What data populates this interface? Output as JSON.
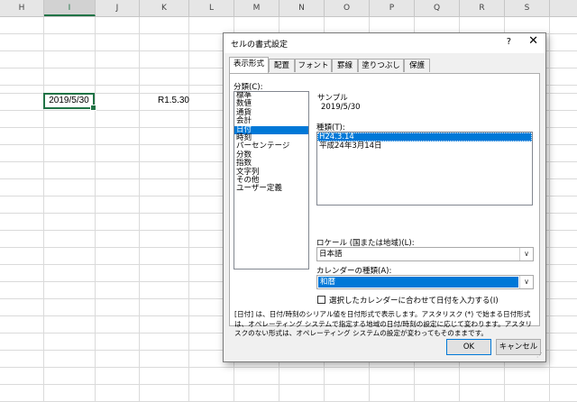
{
  "spreadsheet": {
    "columns": [
      "H",
      "I",
      "J",
      "K",
      "L",
      "M",
      "N",
      "O",
      "P",
      "Q",
      "R",
      "S"
    ],
    "active_cell_value": "2019/5/30",
    "cell_k_value": "R1.5.30"
  },
  "dialog": {
    "title": "セルの書式設定",
    "help_label": "?",
    "close_label": "✕",
    "tabs": [
      "表示形式",
      "配置",
      "フォント",
      "罫線",
      "塗りつぶし",
      "保護"
    ],
    "category_label": "分類(C):",
    "categories": [
      "標準",
      "数値",
      "通貨",
      "会計",
      "日付",
      "時刻",
      "パーセンテージ",
      "分数",
      "指数",
      "文字列",
      "その他",
      "ユーザー定義"
    ],
    "selected_category": "日付",
    "sample_label": "サンプル",
    "sample_value": "2019/5/30",
    "type_label": "種類(T):",
    "types": [
      "H24.3.14",
      "平成24年3月14日"
    ],
    "selected_type": "H24.3.14",
    "locale_label": "ロケール (国または地域)(L):",
    "locale_value": "日本語",
    "calendar_label": "カレンダーの種類(A):",
    "calendar_value": "和暦",
    "checkbox_label": "選択したカレンダーに合わせて日付を入力する(I)",
    "checkbox_checked": false,
    "description": "[日付] は、日付/時刻のシリアル値を日付形式で表示します。アスタリスク (*) で始まる日付形式は、オペレーティング システムで指定する地域の日付/時刻の設定に応じて変わります。アスタリスクのない形式は、オペレーティング システムの設定が変わってもそのままです。",
    "ok_label": "OK",
    "cancel_label": "キャンセル"
  },
  "colors": {
    "accent_green": "#217346",
    "selection_blue": "#0078d7"
  }
}
